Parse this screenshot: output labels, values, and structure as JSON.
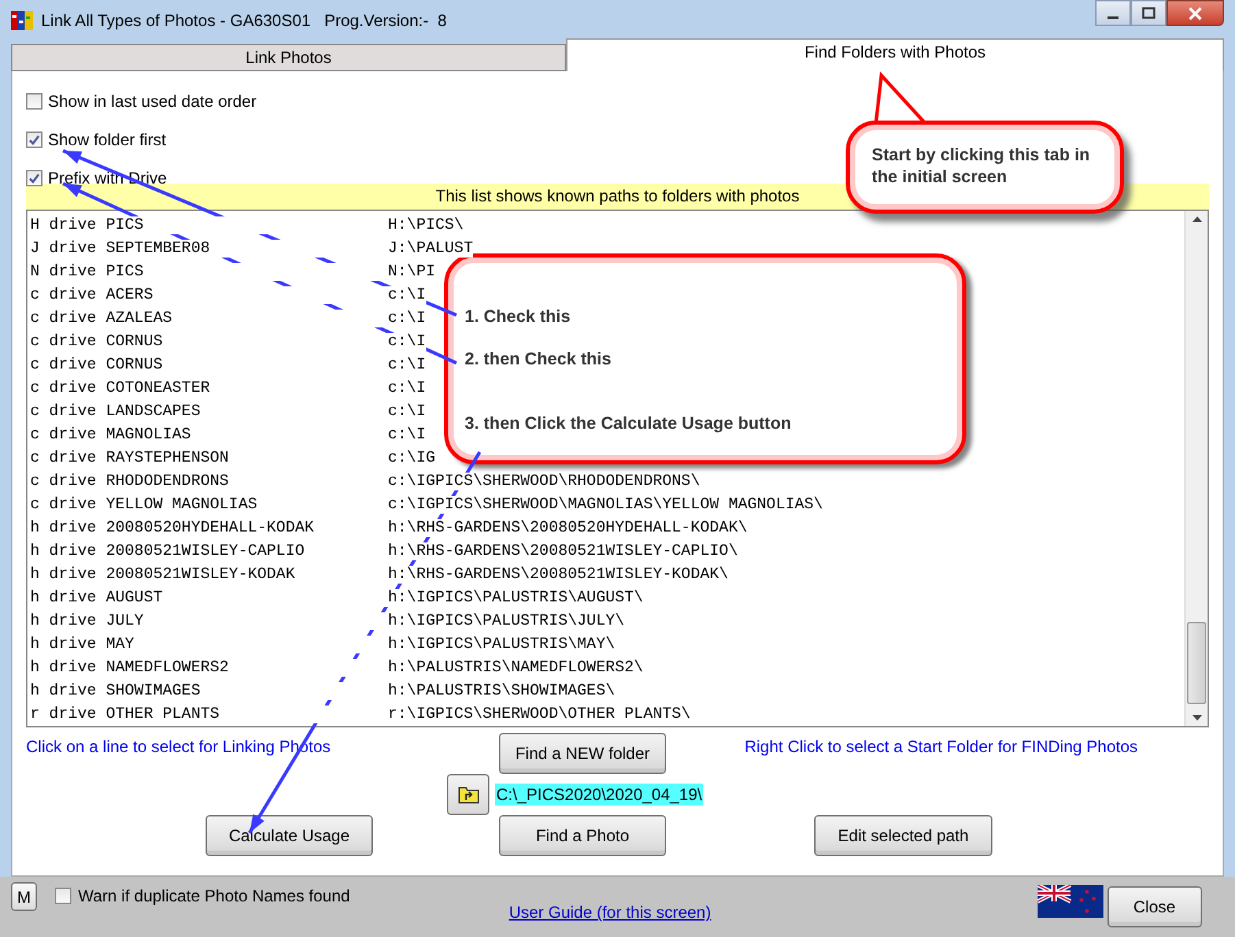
{
  "window": {
    "title": "Link All Types of Photos - GA630S01   Prog.Version:-  8"
  },
  "tabs": [
    {
      "label": "Link Photos",
      "selected": false
    },
    {
      "label": "Find Folders with Photos",
      "selected": true
    }
  ],
  "options": [
    {
      "label": "Show in last used date order",
      "checked": false
    },
    {
      "label": "Show folder first",
      "checked": true
    },
    {
      "label": "Prefix with Drive",
      "checked": true
    }
  ],
  "list": {
    "header": "This list shows known paths to folders with photos",
    "rows": [
      {
        "name": "H drive PICS",
        "path": "H:\\PICS\\"
      },
      {
        "name": "J drive SEPTEMBER08",
        "path": "J:\\PALUST"
      },
      {
        "name": "N drive PICS",
        "path": "N:\\PI"
      },
      {
        "name": "c drive ACERS",
        "path": "c:\\I"
      },
      {
        "name": "c drive AZALEAS",
        "path": "c:\\I"
      },
      {
        "name": "c drive CORNUS",
        "path": "c:\\I"
      },
      {
        "name": "c drive CORNUS",
        "path": "c:\\I"
      },
      {
        "name": "c drive COTONEASTER",
        "path": "c:\\I"
      },
      {
        "name": "c drive LANDSCAPES",
        "path": "c:\\I"
      },
      {
        "name": "c drive MAGNOLIAS",
        "path": "c:\\I"
      },
      {
        "name": "c drive RAYSTEPHENSON",
        "path": "c:\\IG"
      },
      {
        "name": "c drive RHODODENDRONS",
        "path": "c:\\IGPICS\\SHERWOOD\\RHODODENDRONS\\"
      },
      {
        "name": "c drive YELLOW MAGNOLIAS",
        "path": "c:\\IGPICS\\SHERWOOD\\MAGNOLIAS\\YELLOW MAGNOLIAS\\"
      },
      {
        "name": "h drive 20080520HYDEHALL-KODAK",
        "path": "h:\\RHS-GARDENS\\20080520HYDEHALL-KODAK\\"
      },
      {
        "name": "h drive 20080521WISLEY-CAPLIO",
        "path": "h:\\RHS-GARDENS\\20080521WISLEY-CAPLIO\\"
      },
      {
        "name": "h drive 20080521WISLEY-KODAK",
        "path": "h:\\RHS-GARDENS\\20080521WISLEY-KODAK\\"
      },
      {
        "name": "h drive AUGUST",
        "path": "h:\\IGPICS\\PALUSTRIS\\AUGUST\\"
      },
      {
        "name": "h drive JULY",
        "path": "h:\\IGPICS\\PALUSTRIS\\JULY\\"
      },
      {
        "name": "h drive MAY",
        "path": "h:\\IGPICS\\PALUSTRIS\\MAY\\"
      },
      {
        "name": "h drive NAMEDFLOWERS2",
        "path": "h:\\PALUSTRIS\\NAMEDFLOWERS2\\"
      },
      {
        "name": "h drive SHOWIMAGES",
        "path": "h:\\PALUSTRIS\\SHOWIMAGES\\"
      },
      {
        "name": "r drive OTHER PLANTS",
        "path": "r:\\IGPICS\\SHERWOOD\\OTHER PLANTS\\"
      }
    ]
  },
  "hint_left": "Click on a line to select for Linking Photos",
  "hint_right": "Right Click to select a Start Folder for FINDing Photos",
  "find_new_folder_button": "Find a NEW folder",
  "current_path": "C:\\_PICS2020\\2020_04_19\\",
  "buttons": [
    "Calculate Usage",
    "Find a Photo",
    "Edit selected path"
  ],
  "bottom": {
    "m_button": "M",
    "warn": {
      "label": "Warn if duplicate Photo Names found",
      "checked": false
    },
    "user_guide_link": "User Guide (for this screen)",
    "close_button": "Close"
  },
  "callouts": [
    {
      "lines": [
        "Start by clicking this tab in the initial screen"
      ]
    },
    {
      "lines": [
        "1. Check this",
        "2. then Check this",
        "3. then Click the Calculate Usage button"
      ]
    }
  ]
}
